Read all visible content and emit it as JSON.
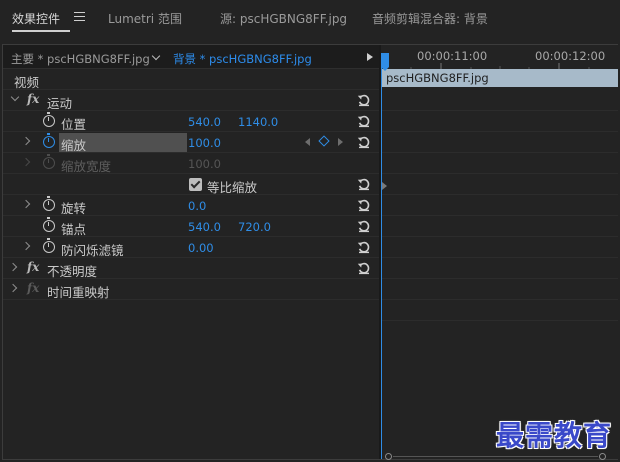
{
  "tabs": [
    {
      "label": "效果控件",
      "active": true
    },
    {
      "label": "Lumetri 范围",
      "active": false
    },
    {
      "label": "源: pscHGBNG8FF.jpg",
      "active": false
    },
    {
      "label": "音频剪辑混合器: 背景",
      "active": false
    }
  ],
  "source_bar": {
    "master_label": "主要 * pscHGBNG8FF.jpg",
    "clip_label": "背景 * pscHGBNG8FF.jpg"
  },
  "section_label": "视频",
  "effects": {
    "motion": {
      "label": "运动",
      "position": {
        "label": "位置",
        "x": "540.0",
        "y": "1140.0"
      },
      "scale": {
        "label": "缩放",
        "value": "100.0"
      },
      "scale_width": {
        "label": "缩放宽度",
        "value": "100.0"
      },
      "uniform_scale": {
        "label": "等比缩放",
        "checked": true
      },
      "rotation": {
        "label": "旋转",
        "value": "0.0"
      },
      "anchor": {
        "label": "锚点",
        "x": "540.0",
        "y": "720.0"
      },
      "flicker": {
        "label": "防闪烁滤镜",
        "value": "0.00"
      }
    },
    "opacity": {
      "label": "不透明度"
    },
    "time_remap": {
      "label": "时间重映射"
    }
  },
  "timeline": {
    "timecodes": [
      "00:00:11:00",
      "00:00:12:00"
    ],
    "clip_name": "pscHGBNG8FF.jpg"
  },
  "watermark": "最需教育",
  "colors": {
    "accent": "#2f8de6",
    "clip_bar": "#a7bac9",
    "panel_bg": "#232323"
  }
}
